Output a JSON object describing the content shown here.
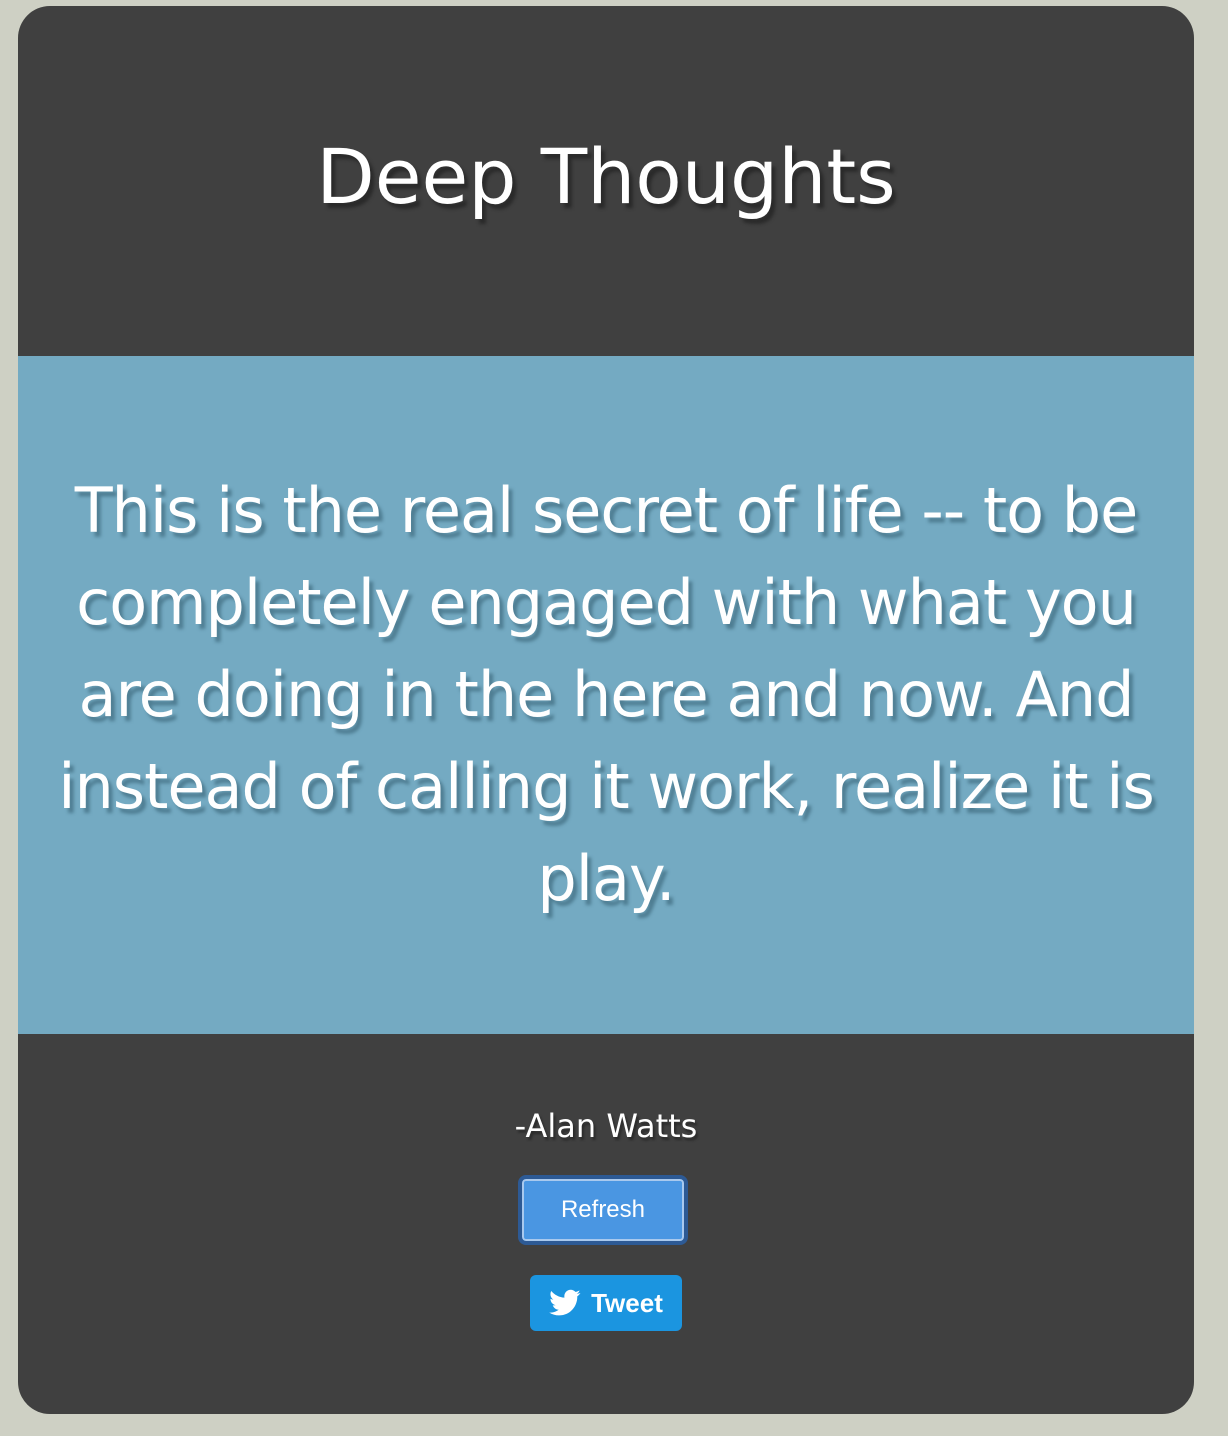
{
  "header": {
    "title": "Deep Thoughts"
  },
  "quote": {
    "text": "This is the real secret of life -- to be completely engaged with what you are doing in the here and now. And instead of calling it work, realize it is play.",
    "author": "-Alan Watts"
  },
  "actions": {
    "refresh_label": "Refresh",
    "tweet_label": "Tweet",
    "tweet_icon": "twitter-bird-icon"
  },
  "colors": {
    "page_background": "#ced0c4",
    "card_background": "#404040",
    "quote_band": "#74aac2",
    "refresh_button": "#4a96e2",
    "tweet_button": "#1b95e0"
  }
}
